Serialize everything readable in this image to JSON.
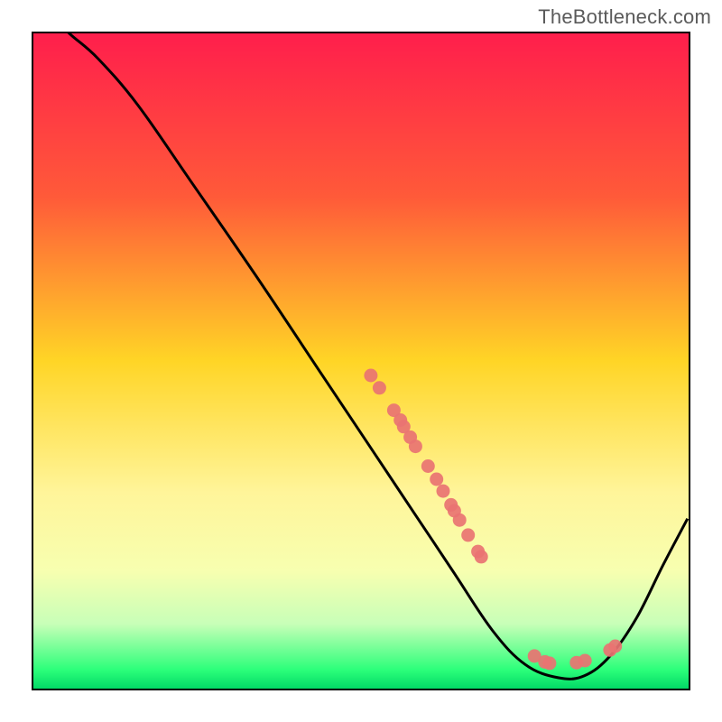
{
  "attribution": "TheBottleneck.com",
  "chart_data": {
    "type": "line",
    "title": "",
    "xlabel": "",
    "ylabel": "",
    "xlim": [
      0,
      100
    ],
    "ylim": [
      0,
      100
    ],
    "gradient_stops": [
      {
        "offset": 0,
        "color": "#ff1e4c"
      },
      {
        "offset": 0.25,
        "color": "#ff5a39"
      },
      {
        "offset": 0.5,
        "color": "#ffd526"
      },
      {
        "offset": 0.7,
        "color": "#fff59a"
      },
      {
        "offset": 0.82,
        "color": "#f7ffb0"
      },
      {
        "offset": 0.9,
        "color": "#c8ffb8"
      },
      {
        "offset": 0.97,
        "color": "#2cff7a"
      },
      {
        "offset": 1.0,
        "color": "#00d866"
      }
    ],
    "curve_points": [
      {
        "x": 4.4,
        "y": 101.0
      },
      {
        "x": 6.0,
        "y": 99.5
      },
      {
        "x": 10.0,
        "y": 96.0
      },
      {
        "x": 16.0,
        "y": 89.0
      },
      {
        "x": 24.0,
        "y": 77.5
      },
      {
        "x": 34.0,
        "y": 63.0
      },
      {
        "x": 44.0,
        "y": 48.0
      },
      {
        "x": 52.0,
        "y": 36.0
      },
      {
        "x": 58.0,
        "y": 27.0
      },
      {
        "x": 64.0,
        "y": 18.0
      },
      {
        "x": 70.0,
        "y": 9.0
      },
      {
        "x": 75.0,
        "y": 3.8
      },
      {
        "x": 80.0,
        "y": 1.8
      },
      {
        "x": 84.0,
        "y": 2.1
      },
      {
        "x": 88.0,
        "y": 5.2
      },
      {
        "x": 92.0,
        "y": 11.0
      },
      {
        "x": 96.0,
        "y": 19.0
      },
      {
        "x": 99.7,
        "y": 26.0
      }
    ],
    "scatter_points": [
      {
        "x": 51.5,
        "y": 47.8
      },
      {
        "x": 52.8,
        "y": 45.9
      },
      {
        "x": 55.0,
        "y": 42.5
      },
      {
        "x": 56.0,
        "y": 41.0
      },
      {
        "x": 56.5,
        "y": 40.0
      },
      {
        "x": 57.5,
        "y": 38.4
      },
      {
        "x": 58.3,
        "y": 37.0
      },
      {
        "x": 60.2,
        "y": 34.0
      },
      {
        "x": 61.5,
        "y": 32.0
      },
      {
        "x": 62.5,
        "y": 30.2
      },
      {
        "x": 63.7,
        "y": 28.1
      },
      {
        "x": 64.2,
        "y": 27.2
      },
      {
        "x": 65.0,
        "y": 25.8
      },
      {
        "x": 66.3,
        "y": 23.5
      },
      {
        "x": 67.8,
        "y": 21.0
      },
      {
        "x": 68.3,
        "y": 20.2
      },
      {
        "x": 76.4,
        "y": 5.1
      },
      {
        "x": 78.0,
        "y": 4.2
      },
      {
        "x": 78.7,
        "y": 4.0
      },
      {
        "x": 82.8,
        "y": 4.1
      },
      {
        "x": 84.1,
        "y": 4.4
      },
      {
        "x": 87.9,
        "y": 6.0
      },
      {
        "x": 88.7,
        "y": 6.6
      }
    ],
    "scatter_color": "#e97372",
    "curve_color": "#000000"
  }
}
